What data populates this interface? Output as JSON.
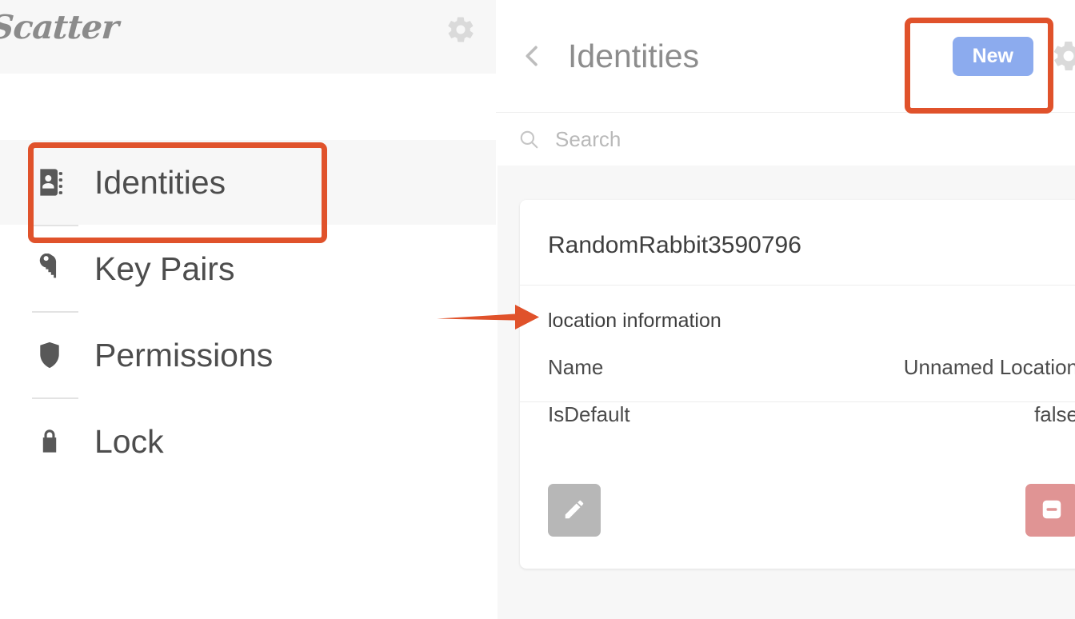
{
  "sidebar": {
    "brand": "Scatter",
    "gear_icon": "gear-icon",
    "items": [
      {
        "label": "Identities",
        "icon": "contact-book-icon",
        "active": true
      },
      {
        "label": "Key Pairs",
        "icon": "key-icon",
        "active": false
      },
      {
        "label": "Permissions",
        "icon": "shield-icon",
        "active": false
      },
      {
        "label": "Lock",
        "icon": "padlock-icon",
        "active": false
      }
    ]
  },
  "panel": {
    "back_icon": "chevron-left-icon",
    "title": "Identities",
    "new_label": "New",
    "gear_icon": "gear-icon",
    "search": {
      "icon": "search-icon",
      "value": "",
      "placeholder": "Search"
    },
    "card": {
      "title": "RandomRabbit3590796",
      "section_label": "location information",
      "rows": [
        {
          "key": "Name",
          "value": "Unnamed Location"
        },
        {
          "key": "IsDefault",
          "value": "false"
        }
      ],
      "edit_icon": "pencil-icon",
      "remove_icon": "minus-square-icon"
    }
  },
  "annotations": {
    "color": "#e0522b",
    "box_identities": "highlight-identities-nav",
    "box_new": "highlight-new-button",
    "arrow_location_information": "arrow-to-location-information"
  },
  "colors": {
    "accent_blue": "#8cabee",
    "annotation_orange": "#e0522b",
    "remove_red": "#e09494",
    "edit_gray": "#b7b7b7",
    "panel_bg": "#f7f7f7"
  }
}
